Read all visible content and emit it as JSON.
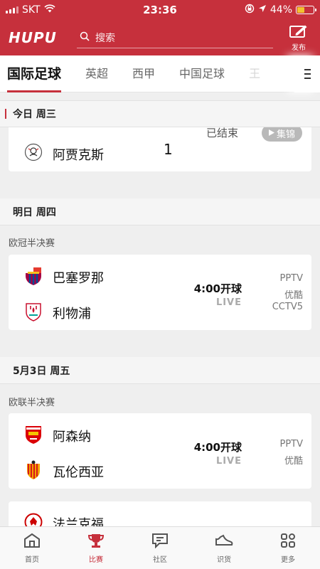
{
  "status_bar": {
    "carrier": "SKT",
    "time": "23:36",
    "battery": "44%"
  },
  "header": {
    "logo": "HUPU",
    "search_placeholder": "搜索",
    "publish_label": "发布"
  },
  "tabs": [
    {
      "label": "国际足球",
      "active": true
    },
    {
      "label": "英超"
    },
    {
      "label": "西甲"
    },
    {
      "label": "中国足球"
    },
    {
      "label": "王"
    }
  ],
  "sections": {
    "today": {
      "header": "今日 周三"
    },
    "tomorrow": {
      "header": "明日 周四"
    },
    "may3": {
      "header": "5月3日 周五"
    }
  },
  "matches": {
    "today": {
      "team2": "阿贾克斯",
      "score2": "1",
      "status": "已结束",
      "highlights": "集锦"
    },
    "ucl": {
      "competition": "欧冠半决赛",
      "team1": "巴塞罗那",
      "team2": "利物浦",
      "kickoff": "4:00开球",
      "live": "LIVE",
      "channels": [
        "PPTV",
        "优酷",
        "CCTV5"
      ]
    },
    "uel": {
      "competition": "欧联半决赛",
      "team1": "阿森纳",
      "team2": "瓦伦西亚",
      "kickoff": "4:00开球",
      "live": "LIVE",
      "channels": [
        "PPTV",
        "优酷"
      ]
    },
    "next": {
      "team1": "法兰克福"
    }
  },
  "bottom_nav": [
    {
      "label": "首页"
    },
    {
      "label": "比赛",
      "active": true
    },
    {
      "label": "社区"
    },
    {
      "label": "识货"
    },
    {
      "label": "更多"
    }
  ],
  "colors": {
    "brand_red": "#c6303c",
    "background": "#efefef"
  }
}
